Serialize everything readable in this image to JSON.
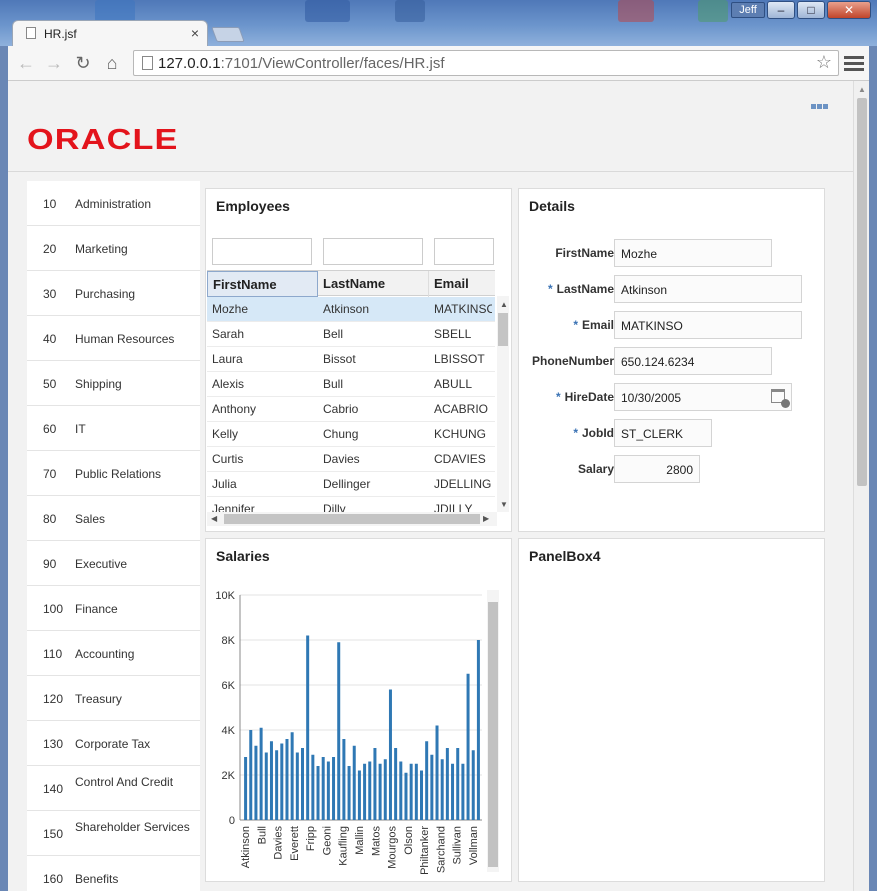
{
  "window": {
    "user_label": "Jeff",
    "minimize": "–",
    "maximize": "□",
    "close": "✕"
  },
  "tab": {
    "title": "HR.jsf",
    "close": "×"
  },
  "browser": {
    "url_host": "127.0.0.1",
    "url_rest": ":7101/ViewController/faces/HR.jsf",
    "back_icon": "arrow-left",
    "forward_icon": "arrow-right",
    "reload_icon": "reload",
    "home_icon": "home",
    "star_icon": "star",
    "menu_icon": "hamburger"
  },
  "brand": {
    "logo": "ORACLE",
    "color": "#e3141c"
  },
  "departments": [
    {
      "id": "10",
      "name": "Administration"
    },
    {
      "id": "20",
      "name": "Marketing"
    },
    {
      "id": "30",
      "name": "Purchasing"
    },
    {
      "id": "40",
      "name": "Human Resources"
    },
    {
      "id": "50",
      "name": "Shipping"
    },
    {
      "id": "60",
      "name": "IT"
    },
    {
      "id": "70",
      "name": "Public Relations"
    },
    {
      "id": "80",
      "name": "Sales"
    },
    {
      "id": "90",
      "name": "Executive"
    },
    {
      "id": "100",
      "name": "Finance"
    },
    {
      "id": "110",
      "name": "Accounting"
    },
    {
      "id": "120",
      "name": "Treasury"
    },
    {
      "id": "130",
      "name": "Corporate Tax"
    },
    {
      "id": "140",
      "name": "Control And Credit"
    },
    {
      "id": "150",
      "name": "Shareholder Services"
    },
    {
      "id": "160",
      "name": "Benefits"
    }
  ],
  "employees": {
    "title": "Employees",
    "columns": [
      "FirstName",
      "LastName",
      "Email"
    ],
    "rows": [
      [
        "Mozhe",
        "Atkinson",
        "MATKINSO"
      ],
      [
        "Sarah",
        "Bell",
        "SBELL"
      ],
      [
        "Laura",
        "Bissot",
        "LBISSOT"
      ],
      [
        "Alexis",
        "Bull",
        "ABULL"
      ],
      [
        "Anthony",
        "Cabrio",
        "ACABRIO"
      ],
      [
        "Kelly",
        "Chung",
        "KCHUNG"
      ],
      [
        "Curtis",
        "Davies",
        "CDAVIES"
      ],
      [
        "Julia",
        "Dellinger",
        "JDELLING"
      ],
      [
        "Jennifer",
        "Dilly",
        "JDILLY"
      ]
    ]
  },
  "details": {
    "title": "Details",
    "fields": [
      {
        "label": "FirstName",
        "value": "Mozhe",
        "required": false
      },
      {
        "label": "LastName",
        "value": "Atkinson",
        "required": true
      },
      {
        "label": "Email",
        "value": "MATKINSO",
        "required": true
      },
      {
        "label": "PhoneNumber",
        "value": "650.124.6234",
        "required": false
      },
      {
        "label": "HireDate",
        "value": "10/30/2005",
        "required": true
      },
      {
        "label": "JobId",
        "value": "ST_CLERK",
        "required": true
      },
      {
        "label": "Salary",
        "value": "2800",
        "required": false
      }
    ]
  },
  "salaries_panel": {
    "title": "Salaries"
  },
  "panelbox4": {
    "title": "PanelBox4"
  },
  "chart_data": {
    "type": "bar",
    "title": "Salaries",
    "ylim": [
      0,
      10000
    ],
    "yticks": [
      "0",
      "2K",
      "4K",
      "6K",
      "8K",
      "10K"
    ],
    "x_tick_labels": [
      "Atkinson",
      "Bull",
      "Davies",
      "Everett",
      "Fripp",
      "Geoni",
      "Kaufling",
      "Mallin",
      "Matos",
      "Mourgos",
      "Olson",
      "Philtanker",
      "Sarchand",
      "Sullivan",
      "Vollman"
    ],
    "values": [
      2800,
      4000,
      3300,
      4100,
      3000,
      3500,
      3100,
      3400,
      3600,
      3900,
      3000,
      3200,
      8200,
      2900,
      2400,
      2800,
      2600,
      2800,
      7900,
      3600,
      2400,
      3300,
      2200,
      2500,
      2600,
      3200,
      2500,
      2700,
      5800,
      3200,
      2600,
      2100,
      2500,
      2500,
      2200,
      3500,
      2900,
      4200,
      2700,
      3200,
      2500,
      3200,
      2500,
      6500,
      3100,
      8000
    ],
    "bar_color": "#2f78b4",
    "grid": true
  }
}
